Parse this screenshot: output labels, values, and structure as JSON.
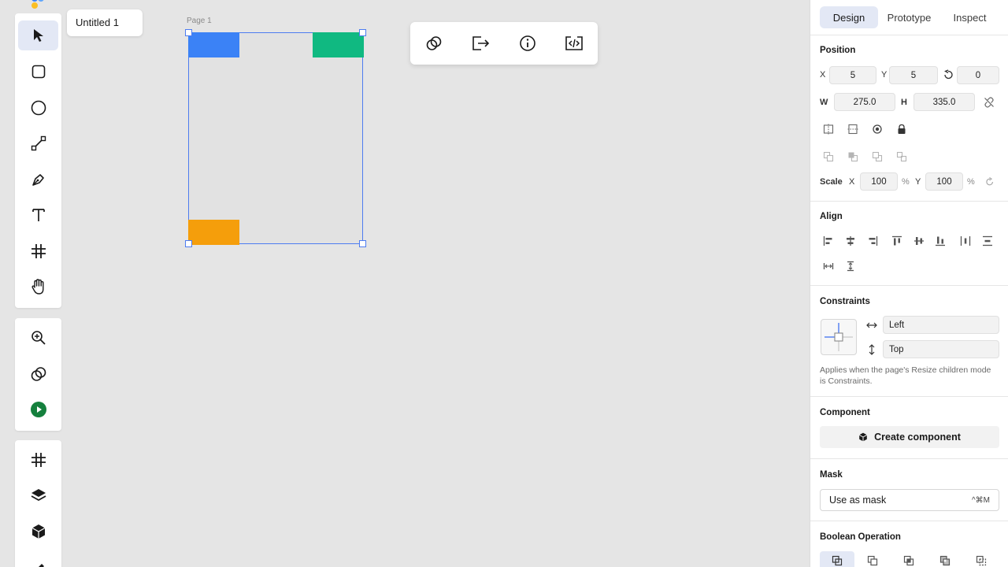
{
  "document": {
    "title": "Untitled 1"
  },
  "canvas": {
    "page_label": "Page 1",
    "colors": {
      "blue": "#3b82f6",
      "green": "#10b981",
      "orange": "#f59e0b",
      "selection": "#4d7cf0"
    }
  },
  "left_toolbar": {
    "tools": [
      "select-icon",
      "rectangle-icon",
      "ellipse-icon",
      "line-icon",
      "pen-icon",
      "text-icon",
      "frame-icon",
      "hand-icon"
    ],
    "secondary": [
      "zoom-icon",
      "link-icon",
      "play-icon"
    ],
    "tertiary": [
      "hash-icon",
      "layers-icon",
      "component-icon"
    ]
  },
  "floating_toolbar": {
    "buttons": [
      "link-icon",
      "export-icon",
      "info-icon",
      "code-icon"
    ]
  },
  "panel": {
    "tabs": [
      "Design",
      "Prototype",
      "Inspect"
    ],
    "position": {
      "title": "Position",
      "x_label": "X",
      "x": "5",
      "y_label": "Y",
      "y": "5",
      "rotation": "0",
      "w_label": "W",
      "w": "275.0",
      "h_label": "H",
      "h": "335.0",
      "scale_label": "Scale",
      "scale_x_label": "X",
      "scale_x": "100",
      "scale_y_label": "Y",
      "scale_y": "100",
      "percent": "%"
    },
    "align": {
      "title": "Align"
    },
    "constraints": {
      "title": "Constraints",
      "horizontal": "Left",
      "vertical": "Top",
      "note": "Applies when the page's Resize children mode is Constraints."
    },
    "component": {
      "title": "Component",
      "button": "Create component"
    },
    "mask": {
      "title": "Mask",
      "button": "Use as mask",
      "shortcut": "^⌘M"
    },
    "boolean": {
      "title": "Boolean Operation"
    }
  }
}
